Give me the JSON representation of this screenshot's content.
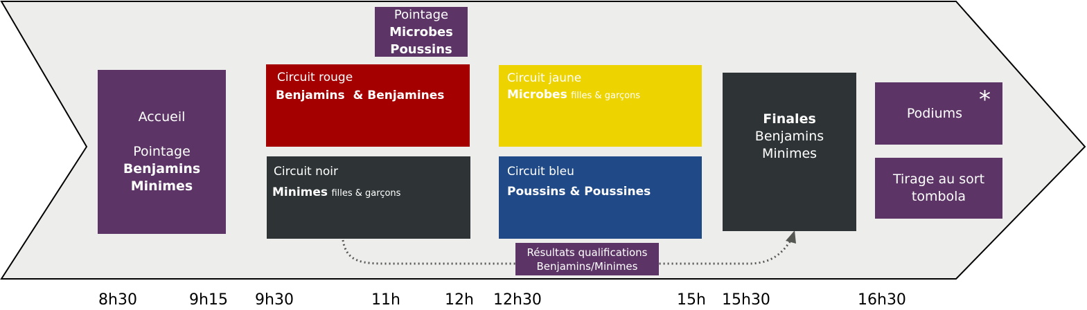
{
  "welcome": {
    "title": "Accueil",
    "checkin": "Pointage",
    "cat1": "Benjamins",
    "cat2": "Minimes"
  },
  "checkin_top": {
    "title": "Pointage",
    "cat1": "Microbes",
    "cat2": "Poussins"
  },
  "circuits": {
    "rouge": {
      "title": "Circuit rouge",
      "group": "Benjamins  & Benjamines",
      "note": ""
    },
    "noir": {
      "title": "Circuit noir",
      "group": "Minimes",
      "note": "filles & garçons"
    },
    "jaune": {
      "title": "Circuit jaune",
      "group": "Microbes",
      "note": "filles & garçons"
    },
    "bleu": {
      "title": "Circuit bleu",
      "group": "Poussins & Poussines",
      "note": ""
    }
  },
  "finals": {
    "title": "Finales",
    "cat1": "Benjamins",
    "cat2": "Minimes"
  },
  "podiums": {
    "label": "Podiums",
    "mark": "*"
  },
  "raffle": {
    "line1": "Tirage au sort",
    "line2": "tombola"
  },
  "results": {
    "line1": "Résultats qualifications",
    "line2": "Benjamins/Minimes"
  },
  "times": [
    "8h30",
    "9h15",
    "9h30",
    "11h",
    "12h",
    "12h30",
    "15h",
    "15h30",
    "16h30"
  ],
  "colors": {
    "arrow_fill": "#ededeb",
    "purple": "#5c3566",
    "red": "#a40000",
    "dark": "#2e3436",
    "yellow": "#edd400",
    "blue": "#204a87",
    "connector": "#555753"
  }
}
